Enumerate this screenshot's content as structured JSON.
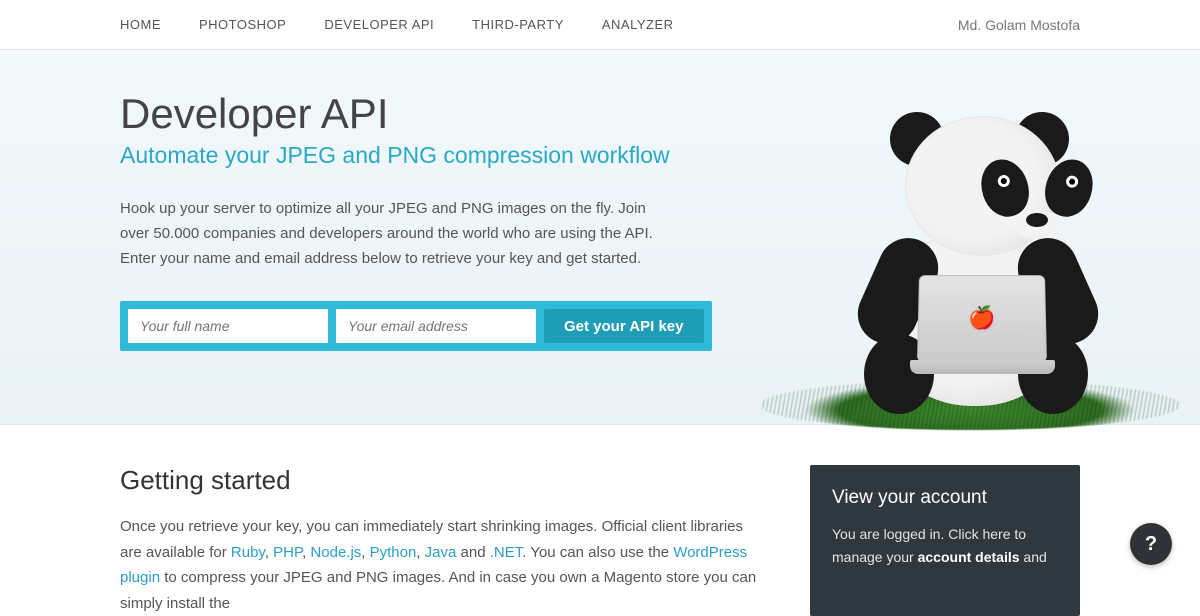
{
  "nav": {
    "items": [
      "HOME",
      "PHOTOSHOP",
      "DEVELOPER API",
      "THIRD-PARTY",
      "ANALYZER"
    ],
    "user": "Md. Golam Mostofa"
  },
  "hero": {
    "title": "Developer API",
    "subtitle": "Automate your JPEG and PNG compression workflow",
    "blurb": "Hook up your server to optimize all your JPEG and PNG images on the fly. Join over 50.000 companies and developers around the world who are using the API. Enter your name and email address below to retrieve your key and get started.",
    "name_placeholder": "Your full name",
    "email_placeholder": "Your email address",
    "cta": "Get your API key"
  },
  "getting_started": {
    "heading": "Getting started",
    "p1a": "Once you retrieve your key, you can immediately start shrinking images. Official client libraries are available for ",
    "libs": [
      "Ruby",
      "PHP",
      "Node.js",
      "Python",
      "Java"
    ],
    "and_word": " and ",
    "dotnet": ".NET",
    "p1b": ". You can also use the ",
    "wp": "WordPress plugin",
    "p1c": " to compress your JPEG and PNG images. And in case you own a Magento store you can simply install the"
  },
  "account_card": {
    "heading": "View your account",
    "line1": "You are logged in. Click here to manage your ",
    "bold": "account details",
    "line2": " and"
  },
  "help": {
    "glyph": "?"
  }
}
